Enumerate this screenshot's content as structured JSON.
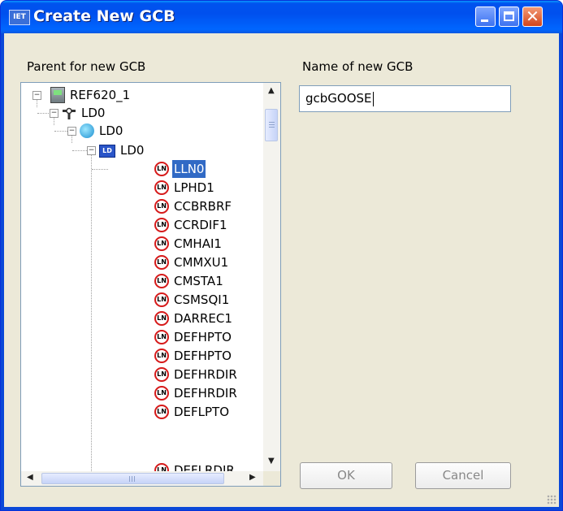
{
  "window": {
    "title": "Create New GCB",
    "app_icon_text": "IET"
  },
  "labels": {
    "parent": "Parent for new GCB",
    "name": "Name of new GCB"
  },
  "name_input": {
    "value": "gcbGOOSE"
  },
  "tree": {
    "root": "REF620_1",
    "access_point": "LD0",
    "server": "LD0",
    "logical_device": "LD0",
    "nodes": [
      "LLN0",
      "LPHD1",
      "CCBRBRF",
      "CCRDIF1",
      "CMHAI1",
      "CMMXU1",
      "CMSTA1",
      "CSMSQI1",
      "DARREC1",
      "DEFHPTO",
      "DEFHPTO",
      "DEFHRDIR",
      "DEFHRDIR",
      "DEFLPTO",
      "DEFLRDIR"
    ],
    "selected": "LLN0",
    "ln_icon_text": "LN",
    "ld_icon_text": "LD"
  },
  "buttons": {
    "ok": "OK",
    "cancel": "Cancel"
  },
  "colors": {
    "titlebar": "#0050ee",
    "selection": "#316ac5",
    "ln_ring": "#d61a1a"
  }
}
